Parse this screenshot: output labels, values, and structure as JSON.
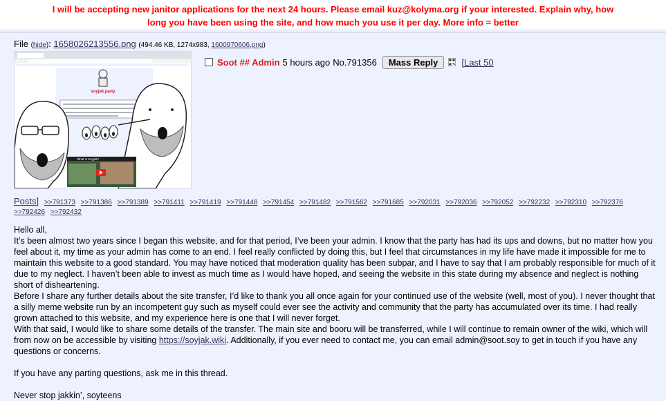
{
  "announcement": {
    "line1": "I will be accepting new janitor applications for the next 24 hours. Please email kuz@kolyma.org if your interested. Explain why, how",
    "line2": "long you have been using the site, and how much you use it per day. More info = better"
  },
  "file": {
    "label": "File",
    "hide_label": "hide",
    "filename": "1658026213556.png",
    "meta_prefix": "(494.46 KB, 1274x983, ",
    "original_name": "1600970606.png",
    "meta_suffix": ")",
    "thumbnail": {
      "site_title": "soyjak.party",
      "video_title": "What is Soyjak?"
    }
  },
  "post": {
    "name": "Soot ## Admin",
    "time": "5 hours ago",
    "number": "No.791356",
    "mass_reply_label": "Mass Reply",
    "last50_label": "[Last 50",
    "posts_label": "Posts]",
    "replies": [
      ">>791373",
      ">>791386",
      ">>791389",
      ">>791411",
      ">>791419",
      ">>791448",
      ">>791454",
      ">>791482",
      ">>791562",
      ">>791685",
      ">>792031",
      ">>792036",
      ">>792052",
      ">>792232",
      ">>792310",
      ">>792376",
      ">>792426",
      ">>792432"
    ],
    "body": {
      "greeting": "Hello all,",
      "para1": "It’s been almost two years since I began this website, and for that period, I’ve been your admin. I know that the party has had its ups and downs, but no matter how you feel about it, my time as your admin has come to an end. I feel really conflicted by doing this, but I feel that circumstances in my life have made it impossible for me to maintain this website to a good standard. You may have noticed that moderation quality has been subpar, and I have to say that I am probably responsible for much of it due to my neglect. I haven’t been able to invest as much time as I would have hoped, and seeing the website in this state during my absence and neglect is nothing short of disheartening.",
      "para2": "Before I share any further details about the site transfer, I’d like to thank you all once again for your continued use of the website (well, most of you). I never thought that a silly meme website run by an incompetent guy such as myself could ever see the activity and community that the party has accumulated over its time. I had really grown attached to this website, and my experience here is one that I will never forget.",
      "para3_before": "With that said, I would like to share some details of the transfer. The main site and booru will be transferred, while I will continue to remain owner of the wiki, which will from now on be accessible by visiting ",
      "para3_link": "https://soyjak.wiki",
      "para3_after": ". Additionally, if you ever need to contact me, you can email admin@soot.soy to get in touch if you have any questions or concerns.",
      "para4": "If you have any parting questions, ask me in this thread.",
      "signoff": "Never stop jakkin’, soyteens"
    }
  },
  "colors": {
    "background": "#eef2ff",
    "banner_text": "#ff0000",
    "name": "#e21c1c",
    "link": "#34345c"
  }
}
